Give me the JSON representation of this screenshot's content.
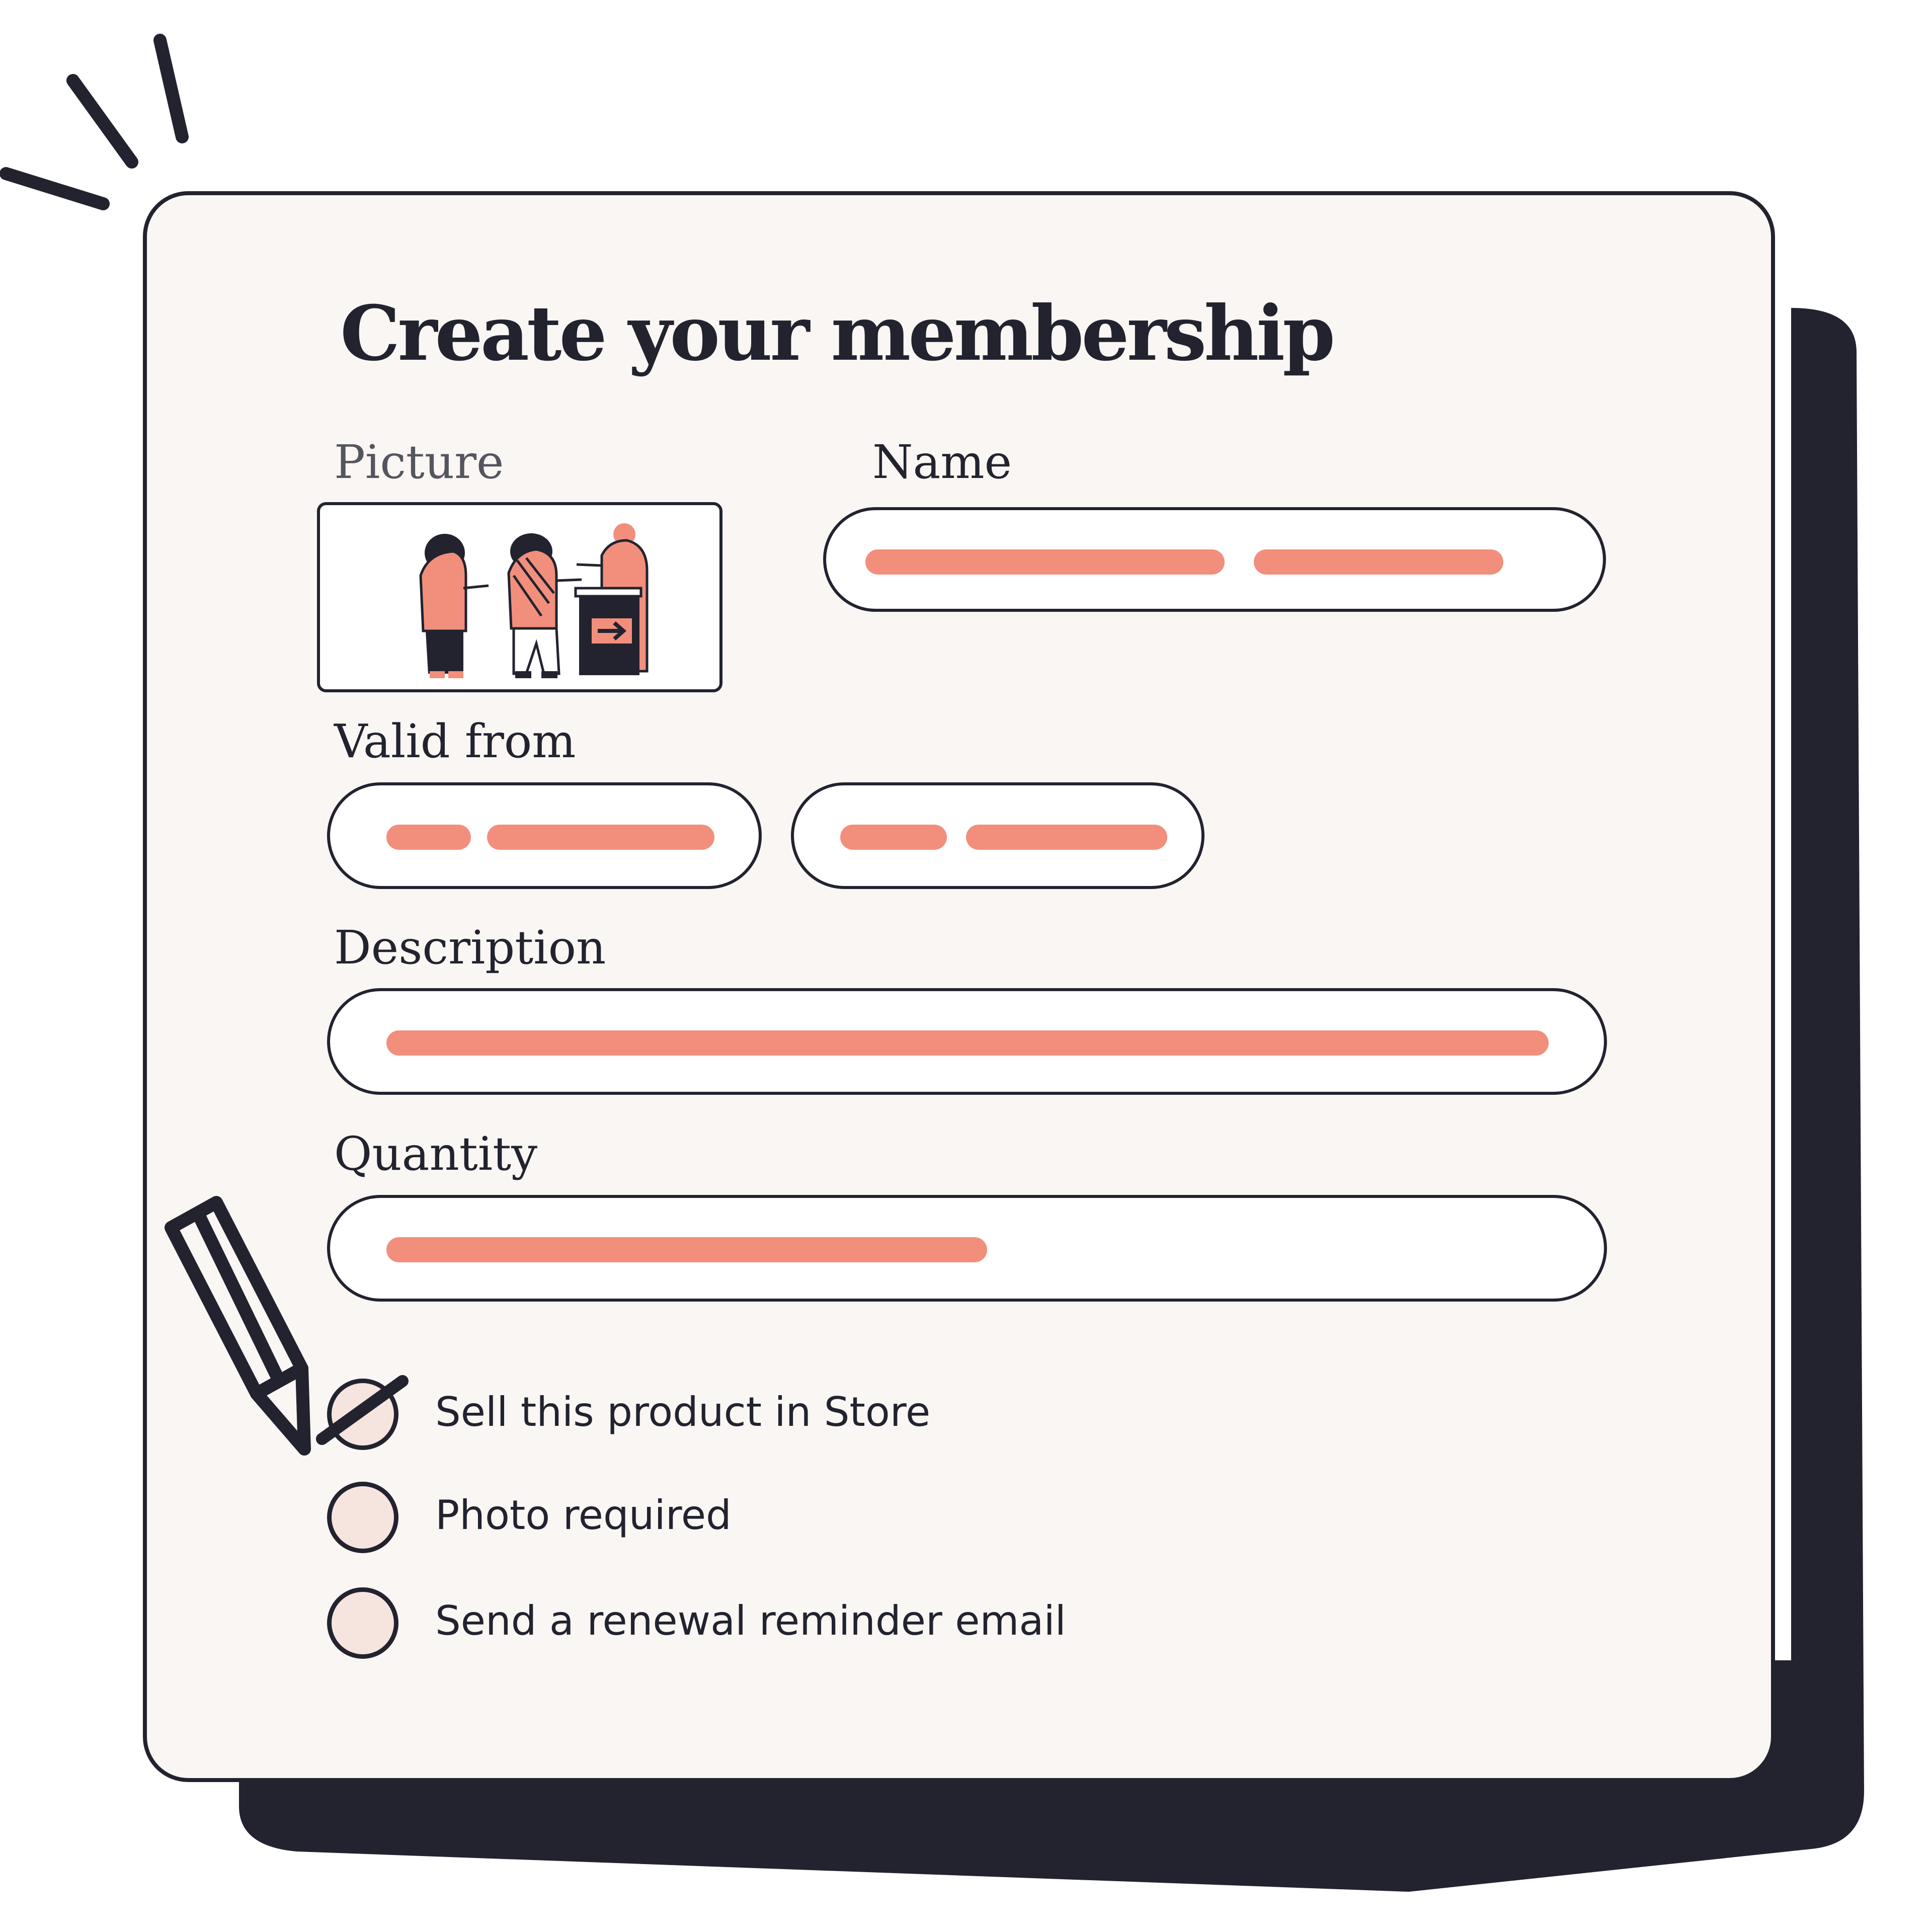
{
  "form": {
    "title": "Create your membership",
    "picture_label": "Picture",
    "name_label": "Name",
    "valid_from_label": "Valid from",
    "description_label": "Description",
    "quantity_label": "Quantity"
  },
  "options": [
    {
      "label": "Sell this product in Store",
      "checked": true
    },
    {
      "label": "Photo required",
      "checked": false
    },
    {
      "label": "Send a renewal reminder email",
      "checked": false
    }
  ],
  "icons": [
    "burst-lines-icon",
    "pencil-icon",
    "people-illustration-icon",
    "arrow-right-icon"
  ],
  "colors": {
    "ink": "#22232f",
    "card": "#f9f6f3",
    "accent": "#f18f7c",
    "radio_fill": "#f6e4df"
  }
}
